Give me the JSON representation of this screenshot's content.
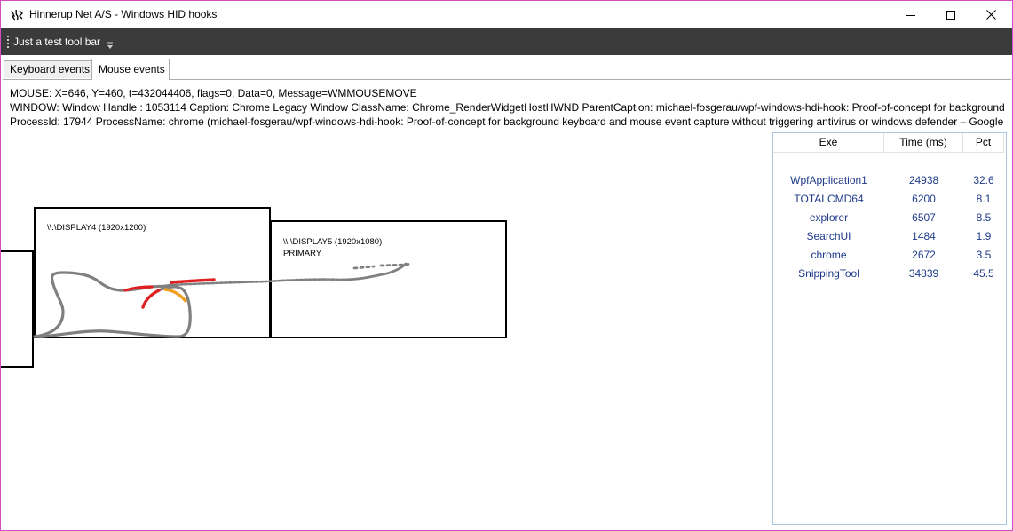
{
  "window": {
    "title": "Hinnerup Net A/S - Windows HID hooks",
    "accent": "#d24fc3"
  },
  "toolbar": {
    "label": "Just a test tool bar"
  },
  "tabs": [
    {
      "label": "Keyboard events",
      "selected": false
    },
    {
      "label": "Mouse events",
      "selected": true
    }
  ],
  "info": {
    "mouse": "MOUSE: X=646, Y=460, t=432044406, flags=0, Data=0, Message=WMMOUSEMOVE",
    "window": "WINDOW: Window Handle : 1053114 Caption: Chrome Legacy Window ClassName: Chrome_RenderWidgetHostHWND ParentCaption: michael-fosgerau/wpf-windows-hdi-hook: Proof-of-concept for background keyboard and mouse event capture without triggering antivirus or windows defender – Google Chrome",
    "process": "ProcessId: 17944 ProcessName: chrome (michael-fosgerau/wpf-windows-hdi-hook: Proof-of-concept for background keyboard and mouse event capture without triggering antivirus or windows defender – Google Chrome)"
  },
  "displays": [
    {
      "name": "\\\\.\\DISPLAY4 (1920x1200)",
      "primary_label": ""
    },
    {
      "name": "\\\\.\\DISPLAY5 (1920x1080)",
      "primary_label": "PRIMARY"
    }
  ],
  "trail_colors": {
    "main": "#808080",
    "red": "#e02020",
    "orange": "#f0a020"
  },
  "grid": {
    "headers": {
      "exe": "Exe",
      "time": "Time (ms)",
      "pct": "Pct"
    },
    "rows": [
      {
        "exe": "WpfApplication1",
        "time": "24938",
        "pct": "32.6"
      },
      {
        "exe": "TOTALCMD64",
        "time": "6200",
        "pct": "8.1"
      },
      {
        "exe": "explorer",
        "time": "6507",
        "pct": "8.5"
      },
      {
        "exe": "SearchUI",
        "time": "1484",
        "pct": "1.9"
      },
      {
        "exe": "chrome",
        "time": "2672",
        "pct": "3.5"
      },
      {
        "exe": "SnippingTool",
        "time": "34839",
        "pct": "45.5"
      }
    ],
    "text_color": "#1e3a8a"
  }
}
